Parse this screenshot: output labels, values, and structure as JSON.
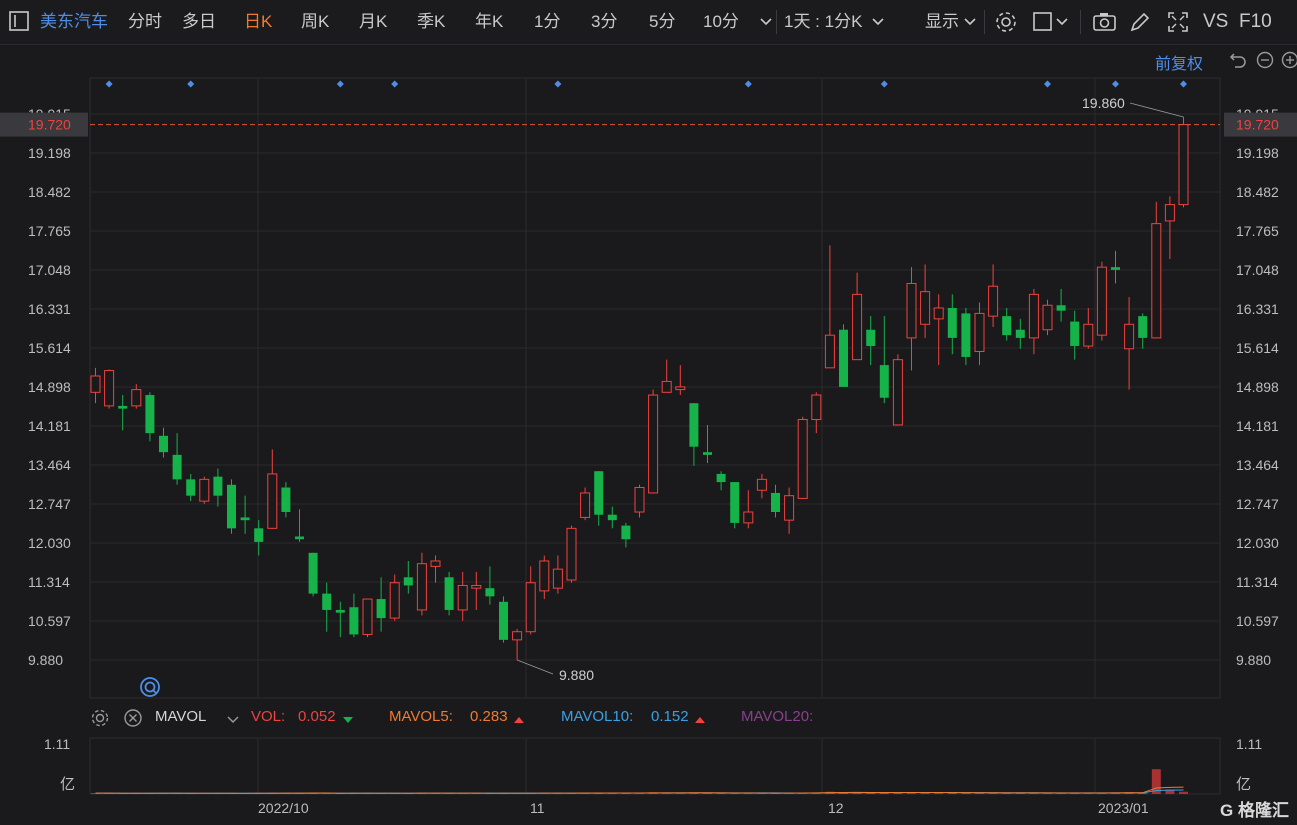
{
  "toolbar": {
    "stock_name": "美东汽车",
    "periods": [
      "分时",
      "多日",
      "日K",
      "周K",
      "月K",
      "季K",
      "年K",
      "1分",
      "3分",
      "5分",
      "10分"
    ],
    "active_period": "日K",
    "interval_label": "1天 : 1分K",
    "display_label": "显示",
    "vs_label": "VS",
    "f10_label": "F10"
  },
  "subbar": {
    "adjust_label": "前复权"
  },
  "colors": {
    "up": "#f0423e",
    "down": "#16b24a",
    "accent_orange": "#f07a2f",
    "blue": "#4e8ee8",
    "mavol5": "#f07a2f",
    "mavol10": "#3aa0e6",
    "mavol20": "#8a3f8f"
  },
  "price_axis": {
    "ticks": [
      "19.915",
      "19.198",
      "18.482",
      "17.765",
      "17.048",
      "16.331",
      "15.614",
      "14.898",
      "14.181",
      "13.464",
      "12.747",
      "12.030",
      "11.314",
      "10.597",
      "9.880"
    ],
    "current_price": "19.720",
    "max_label": "19.860",
    "min_label": "9.880"
  },
  "x_axis": {
    "labels": [
      "2022/10",
      "11",
      "12",
      "2023/01"
    ]
  },
  "volume": {
    "indicator": "MAVOL",
    "vol_label": "VOL:",
    "vol_value": "0.052",
    "mavol5_label": "MAVOL5:",
    "mavol5_value": "0.283",
    "mavol10_label": "MAVOL10:",
    "mavol10_value": "0.152",
    "mavol20_label": "MAVOL20:",
    "axis_top": "1.11",
    "axis_unit": "亿"
  },
  "logo": "G 格隆汇",
  "chart_data": {
    "type": "candlestick",
    "y_range": [
      9.88,
      19.915
    ],
    "candles": [
      {
        "o": 14.8,
        "c": 15.1,
        "h": 15.25,
        "l": 14.6
      },
      {
        "o": 14.55,
        "c": 15.2,
        "h": 15.22,
        "l": 14.5
      },
      {
        "o": 14.55,
        "c": 14.5,
        "h": 14.75,
        "l": 14.1
      },
      {
        "o": 14.55,
        "c": 14.85,
        "h": 14.95,
        "l": 14.5
      },
      {
        "o": 14.75,
        "c": 14.05,
        "h": 14.8,
        "l": 13.9
      },
      {
        "o": 14.0,
        "c": 13.7,
        "h": 14.15,
        "l": 13.6
      },
      {
        "o": 13.65,
        "c": 13.2,
        "h": 14.05,
        "l": 13.1
      },
      {
        "o": 13.2,
        "c": 12.9,
        "h": 13.3,
        "l": 12.8
      },
      {
        "o": 12.8,
        "c": 13.2,
        "h": 13.25,
        "l": 12.75
      },
      {
        "o": 13.25,
        "c": 12.9,
        "h": 13.4,
        "l": 12.7
      },
      {
        "o": 13.1,
        "c": 12.3,
        "h": 13.2,
        "l": 12.2
      },
      {
        "o": 12.5,
        "c": 12.45,
        "h": 12.9,
        "l": 12.2
      },
      {
        "o": 12.3,
        "c": 12.05,
        "h": 12.45,
        "l": 11.8
      },
      {
        "o": 12.3,
        "c": 13.3,
        "h": 13.75,
        "l": 12.3
      },
      {
        "o": 13.05,
        "c": 12.6,
        "h": 13.15,
        "l": 12.5
      },
      {
        "o": 12.15,
        "c": 12.1,
        "h": 12.65,
        "l": 12.05
      },
      {
        "o": 11.85,
        "c": 11.1,
        "h": 11.85,
        "l": 11.05
      },
      {
        "o": 11.1,
        "c": 10.8,
        "h": 11.3,
        "l": 10.4
      },
      {
        "o": 10.8,
        "c": 10.75,
        "h": 10.95,
        "l": 10.3
      },
      {
        "o": 10.85,
        "c": 10.35,
        "h": 11.1,
        "l": 10.3
      },
      {
        "o": 10.35,
        "c": 11.0,
        "h": 11.0,
        "l": 10.3
      },
      {
        "o": 11.0,
        "c": 10.65,
        "h": 11.4,
        "l": 10.4
      },
      {
        "o": 10.65,
        "c": 11.3,
        "h": 11.45,
        "l": 10.6
      },
      {
        "o": 11.4,
        "c": 11.25,
        "h": 11.7,
        "l": 11.1
      },
      {
        "o": 10.8,
        "c": 11.65,
        "h": 11.85,
        "l": 10.7
      },
      {
        "o": 11.6,
        "c": 11.7,
        "h": 11.8,
        "l": 11.3
      },
      {
        "o": 11.4,
        "c": 10.8,
        "h": 11.5,
        "l": 10.7
      },
      {
        "o": 10.8,
        "c": 11.25,
        "h": 11.5,
        "l": 10.6
      },
      {
        "o": 11.2,
        "c": 11.25,
        "h": 11.5,
        "l": 10.8
      },
      {
        "o": 11.2,
        "c": 11.05,
        "h": 11.6,
        "l": 10.9
      },
      {
        "o": 10.95,
        "c": 10.25,
        "h": 11.05,
        "l": 10.2
      },
      {
        "o": 10.25,
        "c": 10.4,
        "h": 10.45,
        "l": 9.88
      },
      {
        "o": 10.4,
        "c": 11.3,
        "h": 11.6,
        "l": 10.35
      },
      {
        "o": 11.15,
        "c": 11.7,
        "h": 11.8,
        "l": 11.0
      },
      {
        "o": 11.2,
        "c": 11.55,
        "h": 11.8,
        "l": 11.1
      },
      {
        "o": 11.35,
        "c": 12.3,
        "h": 12.35,
        "l": 11.3
      },
      {
        "o": 12.5,
        "c": 12.95,
        "h": 13.05,
        "l": 12.45
      },
      {
        "o": 13.35,
        "c": 12.55,
        "h": 13.35,
        "l": 12.35
      },
      {
        "o": 12.55,
        "c": 12.45,
        "h": 12.7,
        "l": 12.3
      },
      {
        "o": 12.35,
        "c": 12.1,
        "h": 12.4,
        "l": 11.95
      },
      {
        "o": 12.6,
        "c": 13.05,
        "h": 13.1,
        "l": 12.5
      },
      {
        "o": 12.95,
        "c": 14.75,
        "h": 14.85,
        "l": 12.95
      },
      {
        "o": 14.8,
        "c": 15.0,
        "h": 15.4,
        "l": 14.8
      },
      {
        "o": 14.85,
        "c": 14.9,
        "h": 15.3,
        "l": 14.75
      },
      {
        "o": 14.6,
        "c": 13.8,
        "h": 14.6,
        "l": 13.45
      },
      {
        "o": 13.7,
        "c": 13.65,
        "h": 14.2,
        "l": 13.5
      },
      {
        "o": 13.3,
        "c": 13.15,
        "h": 13.35,
        "l": 13.0
      },
      {
        "o": 13.15,
        "c": 12.4,
        "h": 13.15,
        "l": 12.3
      },
      {
        "o": 12.4,
        "c": 12.6,
        "h": 13.0,
        "l": 12.3
      },
      {
        "o": 13.0,
        "c": 13.2,
        "h": 13.3,
        "l": 12.85
      },
      {
        "o": 12.95,
        "c": 12.6,
        "h": 13.1,
        "l": 12.5
      },
      {
        "o": 12.45,
        "c": 12.9,
        "h": 13.05,
        "l": 12.2
      },
      {
        "o": 12.85,
        "c": 14.3,
        "h": 14.35,
        "l": 12.85
      },
      {
        "o": 14.3,
        "c": 14.75,
        "h": 14.8,
        "l": 14.05
      },
      {
        "o": 15.25,
        "c": 15.85,
        "h": 17.5,
        "l": 15.25
      },
      {
        "o": 15.95,
        "c": 14.9,
        "h": 16.05,
        "l": 14.9
      },
      {
        "o": 15.4,
        "c": 16.6,
        "h": 17.0,
        "l": 15.4
      },
      {
        "o": 15.95,
        "c": 15.65,
        "h": 16.2,
        "l": 15.3
      },
      {
        "o": 15.3,
        "c": 14.7,
        "h": 16.2,
        "l": 14.6
      },
      {
        "o": 14.2,
        "c": 15.4,
        "h": 15.5,
        "l": 14.2
      },
      {
        "o": 15.8,
        "c": 16.8,
        "h": 17.1,
        "l": 15.2
      },
      {
        "o": 16.05,
        "c": 16.65,
        "h": 17.15,
        "l": 15.8
      },
      {
        "o": 16.15,
        "c": 16.35,
        "h": 16.6,
        "l": 15.3
      },
      {
        "o": 16.35,
        "c": 15.8,
        "h": 16.6,
        "l": 15.5
      },
      {
        "o": 16.25,
        "c": 15.45,
        "h": 16.35,
        "l": 15.3
      },
      {
        "o": 15.55,
        "c": 16.25,
        "h": 16.45,
        "l": 15.3
      },
      {
        "o": 16.2,
        "c": 16.75,
        "h": 17.15,
        "l": 16.0
      },
      {
        "o": 16.2,
        "c": 15.85,
        "h": 16.35,
        "l": 15.75
      },
      {
        "o": 15.95,
        "c": 15.8,
        "h": 16.15,
        "l": 15.6
      },
      {
        "o": 15.8,
        "c": 16.6,
        "h": 16.7,
        "l": 15.5
      },
      {
        "o": 15.95,
        "c": 16.4,
        "h": 16.5,
        "l": 15.85
      },
      {
        "o": 16.4,
        "c": 16.3,
        "h": 16.7,
        "l": 16.1
      },
      {
        "o": 16.1,
        "c": 15.65,
        "h": 16.3,
        "l": 15.4
      },
      {
        "o": 15.65,
        "c": 16.05,
        "h": 16.35,
        "l": 15.6
      },
      {
        "o": 15.85,
        "c": 17.1,
        "h": 17.2,
        "l": 15.75
      },
      {
        "o": 17.1,
        "c": 17.05,
        "h": 17.4,
        "l": 16.8
      },
      {
        "o": 15.6,
        "c": 16.05,
        "h": 16.55,
        "l": 14.85
      },
      {
        "o": 16.2,
        "c": 15.8,
        "h": 16.25,
        "l": 15.6
      },
      {
        "o": 15.8,
        "c": 17.9,
        "h": 18.3,
        "l": 15.8
      },
      {
        "o": 17.95,
        "c": 18.25,
        "h": 18.4,
        "l": 17.25
      },
      {
        "o": 18.25,
        "c": 19.72,
        "h": 19.86,
        "l": 18.2
      }
    ],
    "markers_candle_index": [
      1,
      7,
      18,
      22,
      34,
      48,
      58,
      70,
      75,
      80
    ],
    "volume_max": 1.11,
    "volumes": [
      0.02,
      0.02,
      0.01,
      0.02,
      0.02,
      0.02,
      0.02,
      0.01,
      0.02,
      0.01,
      0.02,
      0.01,
      0.02,
      0.03,
      0.02,
      0.02,
      0.02,
      0.02,
      0.01,
      0.02,
      0.02,
      0.02,
      0.02,
      0.01,
      0.03,
      0.02,
      0.02,
      0.02,
      0.01,
      0.02,
      0.02,
      0.02,
      0.02,
      0.02,
      0.02,
      0.02,
      0.03,
      0.02,
      0.02,
      0.02,
      0.02,
      0.04,
      0.03,
      0.02,
      0.03,
      0.02,
      0.02,
      0.02,
      0.02,
      0.02,
      0.02,
      0.02,
      0.03,
      0.03,
      0.05,
      0.03,
      0.04,
      0.02,
      0.03,
      0.03,
      0.04,
      0.03,
      0.03,
      0.02,
      0.03,
      0.03,
      0.03,
      0.02,
      0.02,
      0.03,
      0.02,
      0.02,
      0.02,
      0.02,
      0.03,
      0.03,
      0.04,
      0.02,
      0.55,
      0.1,
      0.05
    ]
  }
}
